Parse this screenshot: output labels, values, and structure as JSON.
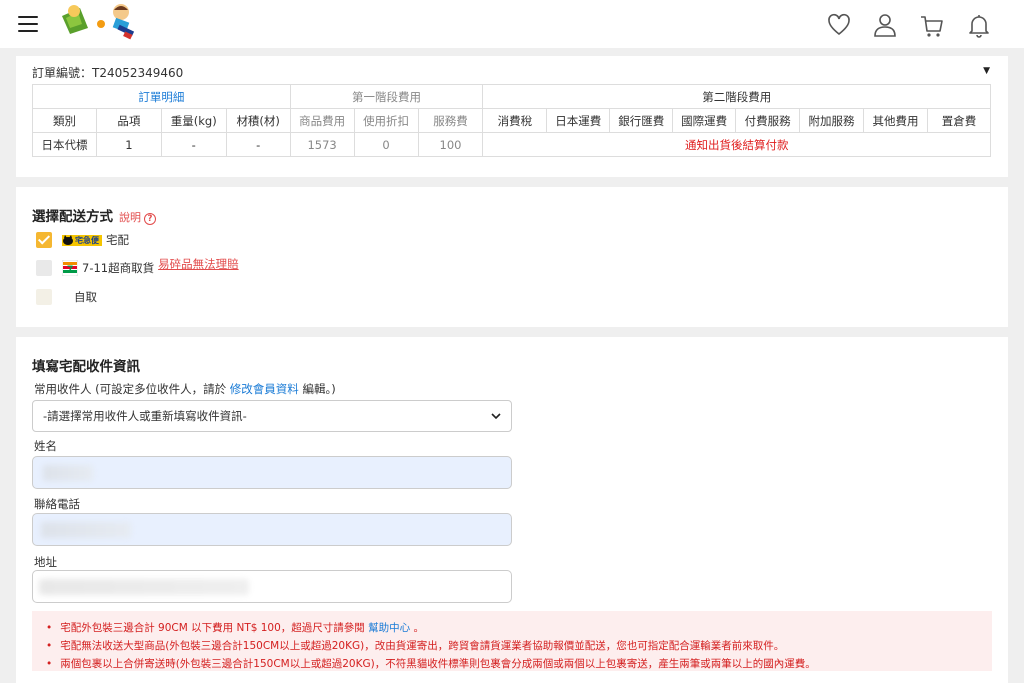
{
  "header": {
    "menu_icon": "hamburger-menu-icon",
    "logo_icon": "brand-logo",
    "icons": [
      "heart-icon",
      "user-icon",
      "cart-icon",
      "bell-icon"
    ]
  },
  "order": {
    "order_no": "訂單編號：T24052349460",
    "groups": {
      "detail": "訂單明細",
      "stage1": "第一階段費用",
      "stage2": "第二階段費用"
    },
    "headers": [
      "類別",
      "品項",
      "重量(kg)",
      "材積(材)",
      "商品費用",
      "使用折扣",
      "服務費",
      "消費稅",
      "日本運費",
      "銀行匯費",
      "國際運費",
      "付費服務",
      "附加服務",
      "其他費用",
      "置倉費"
    ],
    "row": [
      "日本代標",
      "1",
      "-",
      "-",
      "1573",
      "0",
      "100"
    ],
    "stage2_note": "通知出貨後結算付款"
  },
  "shipping": {
    "title": "選擇配送方式",
    "help": "說明",
    "help_icon": "?",
    "options": [
      {
        "logo": "宅急便",
        "label": "宅配",
        "checked": true
      },
      {
        "logo": "7-11-icon",
        "label": "7-11超商取貨",
        "link": "易碎品無法理賠",
        "checked": false
      },
      {
        "label": "自取",
        "checked": false
      }
    ]
  },
  "recipient": {
    "title": "填寫宅配收件資訊",
    "hint_prefix": "常用收件人 (可設定多位收件人，請於 ",
    "hint_link": "修改會員資料",
    "hint_suffix": " 編輯。)",
    "select_value": "-請選擇常用收件人或重新填寫收件資訊-",
    "name_label": "姓名",
    "phone_label": "聯絡電話",
    "address_label": "地址"
  },
  "notices": {
    "line1_prefix": "宅配外包裝三邊合計 90CM 以下費用 NT$ 100，超過尺寸請參閱 ",
    "line1_link": "幫助中心",
    "line1_suffix": " 。",
    "line2": "宅配無法收送大型商品(外包裝三邊合計150CM以上或超過20KG)，改由貨運寄出，跨貿會請貨運業者協助報價並配送，您也可指定配合運輸業者前來取件。",
    "line3": "兩個包裹以上合併寄送時(外包裝三邊合計150CM以上或超過20KG)，不符黑貓收件標準則包裹會分成兩個或兩個以上包裹寄送，產生兩筆或兩筆以上的國內運費。"
  },
  "colors": {
    "accent_yellow": "#f5b731",
    "link_blue": "#1a7bd6",
    "alert_red": "#e02020",
    "notice_bg": "#fdeeee"
  }
}
